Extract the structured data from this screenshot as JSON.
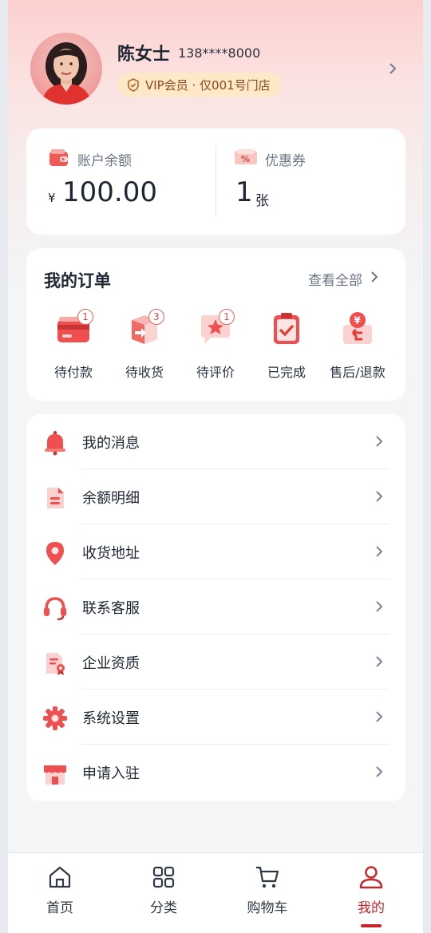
{
  "profile": {
    "name": "陈女士",
    "phone": "138****8000",
    "vip_text": "VIP会员 · 仅001号门店"
  },
  "balance": {
    "label": "账户余额",
    "currency": "¥",
    "value": "100.00"
  },
  "coupon": {
    "label": "优惠券",
    "value": "1",
    "unit": "张"
  },
  "orders": {
    "title": "我的订单",
    "view_all": "查看全部",
    "items": [
      {
        "label": "待付款",
        "badge": "1",
        "icon": "wallet-card-icon"
      },
      {
        "label": "待收货",
        "badge": "3",
        "icon": "package-icon"
      },
      {
        "label": "待评价",
        "badge": "1",
        "icon": "star-comment-icon"
      },
      {
        "label": "已完成",
        "badge": "",
        "icon": "clipboard-check-icon"
      },
      {
        "label": "售后/退款",
        "badge": "",
        "icon": "refund-icon"
      }
    ]
  },
  "menu": [
    {
      "label": "我的消息",
      "icon": "bell-icon"
    },
    {
      "label": "余额明细",
      "icon": "document-icon"
    },
    {
      "label": "收货地址",
      "icon": "location-pin-icon"
    },
    {
      "label": "联系客服",
      "icon": "headset-icon"
    },
    {
      "label": "企业资质",
      "icon": "certificate-icon"
    },
    {
      "label": "系统设置",
      "icon": "gear-icon"
    },
    {
      "label": "申请入驻",
      "icon": "store-icon"
    }
  ],
  "tabbar": {
    "items": [
      {
        "label": "首页",
        "icon": "home-icon"
      },
      {
        "label": "分类",
        "icon": "grid-icon"
      },
      {
        "label": "购物车",
        "icon": "cart-icon"
      },
      {
        "label": "我的",
        "icon": "user-icon"
      }
    ],
    "active": "我的"
  },
  "colors": {
    "accent": "#c8242a",
    "icon_red": "#ef4f4f",
    "vip_bg": "#fde9c7"
  }
}
